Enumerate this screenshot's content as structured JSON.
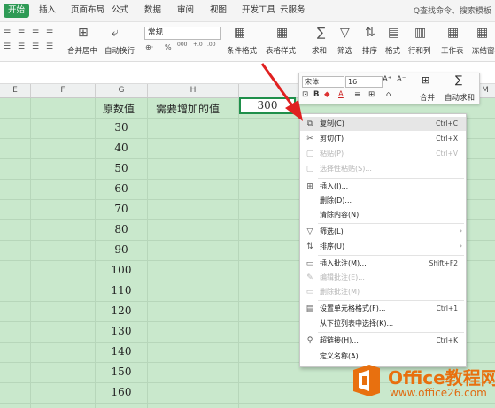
{
  "menubar": {
    "tabs": [
      "开始",
      "插入",
      "页面布局",
      "公式",
      "数据",
      "审阅",
      "视图",
      "开发工具",
      "云服务"
    ],
    "search": "Q查找命令、搜索模板"
  },
  "ribbon": {
    "merge_label": "合并居中",
    "wrap_label": "自动换行",
    "number_format": "常规",
    "percent": "%",
    "thousands": "000",
    "cond_format": "条件格式",
    "table_style": "表格样式",
    "sum": "求和",
    "filter": "筛选",
    "sort": "排序",
    "format": "格式",
    "row_col": "行和列",
    "sheet": "工作表",
    "freeze": "冻结窗格"
  },
  "columns": [
    "E",
    "F",
    "G",
    "H",
    "",
    "",
    "M"
  ],
  "sheet": {
    "header_g": "原数值",
    "header_h": "需要增加的值",
    "selected_value": "300",
    "values": [
      "30",
      "40",
      "50",
      "60",
      "70",
      "80",
      "90",
      "100",
      "110",
      "120",
      "130",
      "140",
      "150",
      "160"
    ]
  },
  "minibar": {
    "font": "宋体",
    "size": "16",
    "grow": "A⁺",
    "shrink": "A⁻",
    "merge": "合并",
    "autosum": "自动求和"
  },
  "context_menu": {
    "items": [
      {
        "label": "复制(C)",
        "shortcut": "Ctrl+C",
        "icon": "copy-icon"
      },
      {
        "label": "剪切(T)",
        "shortcut": "Ctrl+X",
        "icon": "scissors-icon"
      },
      {
        "label": "粘贴(P)",
        "shortcut": "Ctrl+V",
        "icon": "paste-icon"
      },
      {
        "label": "选择性粘贴(S)...",
        "shortcut": "",
        "icon": "paste-special-icon"
      },
      {
        "label": "插入(I)...",
        "shortcut": "",
        "icon": "insert-icon"
      },
      {
        "label": "删除(D)...",
        "shortcut": "",
        "icon": ""
      },
      {
        "label": "清除内容(N)",
        "shortcut": "",
        "icon": ""
      },
      {
        "label": "筛选(L)",
        "shortcut": "",
        "icon": "filter-icon"
      },
      {
        "label": "排序(U)",
        "shortcut": "",
        "icon": "sort-icon"
      },
      {
        "label": "插入批注(M)...",
        "shortcut": "Shift+F2",
        "icon": "comment-icon"
      },
      {
        "label": "编辑批注(E)...",
        "shortcut": "",
        "icon": "edit-comment-icon"
      },
      {
        "label": "删除批注(M)",
        "shortcut": "",
        "icon": "delete-comment-icon"
      },
      {
        "label": "设置单元格格式(F)...",
        "shortcut": "Ctrl+1",
        "icon": "format-cells-icon"
      },
      {
        "label": "从下拉列表中选择(K)...",
        "shortcut": "",
        "icon": ""
      },
      {
        "label": "超链接(H)...",
        "shortcut": "Ctrl+K",
        "icon": "link-icon"
      },
      {
        "label": "定义名称(A)...",
        "shortcut": "",
        "icon": ""
      }
    ]
  },
  "watermark": {
    "brand": "Office教程网",
    "url": "www.office26.com"
  },
  "colors": {
    "accent": "#2e9a55",
    "grid_bg": "#c9e8cc",
    "arrow": "#e02020",
    "watermark": "#e8700f"
  }
}
